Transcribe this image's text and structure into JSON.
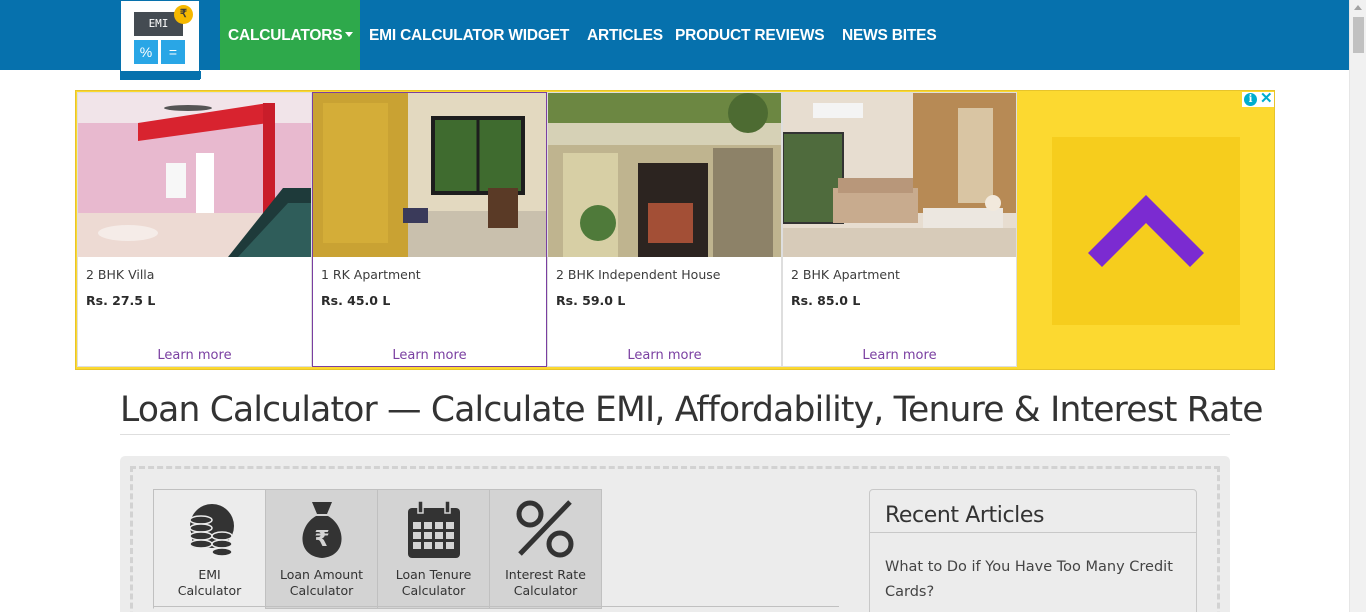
{
  "logo": {
    "screen_text": "EMI",
    "coin": "₹",
    "key_left": "%",
    "key_right": "="
  },
  "nav": {
    "items": [
      "CALCULATORS",
      "EMI CALCULATOR WIDGET",
      "ARTICLES",
      "PRODUCT REVIEWS",
      "NEWS BITES"
    ],
    "active_color": "#2ea94b",
    "bar_color": "#0671ad"
  },
  "ad": {
    "cards": [
      {
        "title": "2 BHK Villa",
        "price": "Rs. 27.5 L",
        "cta": "Learn more"
      },
      {
        "title": "1 RK Apartment",
        "price": "Rs. 45.0 L",
        "cta": "Learn more"
      },
      {
        "title": "2 BHK Independent House",
        "price": "Rs. 59.0 L",
        "cta": "Learn more"
      },
      {
        "title": "2 BHK Apartment",
        "price": "Rs. 85.0 L",
        "cta": "Learn more"
      }
    ],
    "info_glyph": "i",
    "close_glyph": "✕",
    "brand_color": "#fcd930",
    "cta_color": "#7a3fa1"
  },
  "page": {
    "title": "Loan Calculator — Calculate EMI, Affordability, Tenure & Interest Rate"
  },
  "calculator": {
    "tabs": [
      {
        "line1": "EMI",
        "line2": "Calculator",
        "icon": "coins-icon"
      },
      {
        "line1": "Loan Amount",
        "line2": "Calculator",
        "icon": "money-bag-icon"
      },
      {
        "line1": "Loan Tenure",
        "line2": "Calculator",
        "icon": "calendar-icon"
      },
      {
        "line1": "Interest Rate",
        "line2": "Calculator",
        "icon": "percent-icon"
      }
    ],
    "selected_tab": "EMI"
  },
  "sidebar": {
    "title": "Recent Articles",
    "articles": [
      "What to Do if You Have Too Many Credit Cards?"
    ]
  }
}
